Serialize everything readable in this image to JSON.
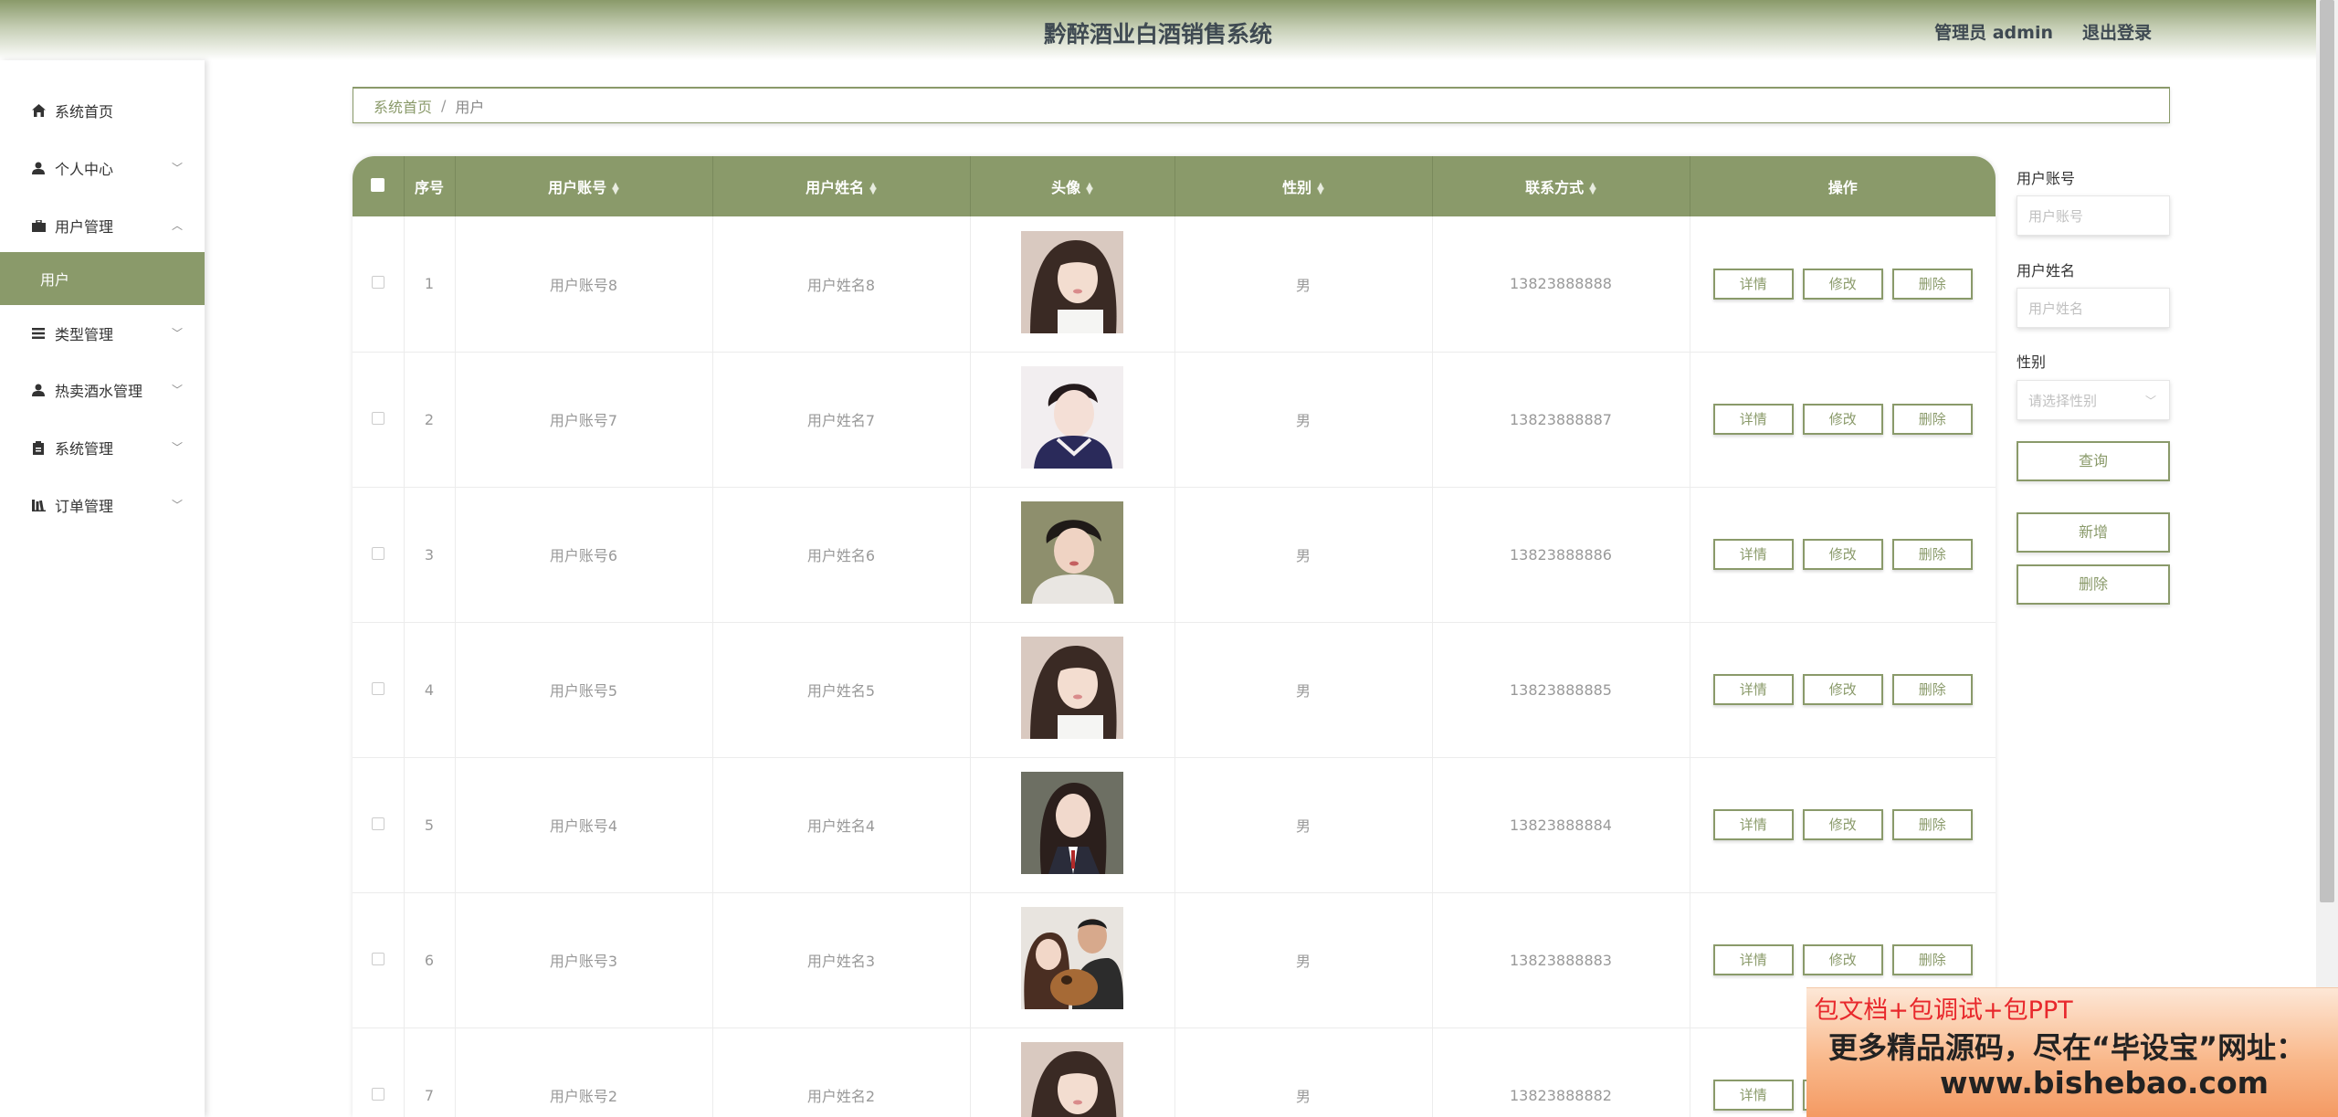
{
  "header": {
    "title": "黔醉酒业白酒销售系统",
    "user_label": "管理员 admin",
    "logout_label": "退出登录"
  },
  "sidebar": {
    "items": [
      {
        "label": "系统首页",
        "icon": "home-icon",
        "expandable": false
      },
      {
        "label": "个人中心",
        "icon": "user-icon",
        "expandable": true,
        "expanded": false
      },
      {
        "label": "用户管理",
        "icon": "briefcase-icon",
        "expandable": true,
        "expanded": true
      },
      {
        "label": "用户",
        "icon": "",
        "expandable": false,
        "active": true
      },
      {
        "label": "类型管理",
        "icon": "list-icon",
        "expandable": true,
        "expanded": false
      },
      {
        "label": "热卖酒水管理",
        "icon": "user-icon",
        "expandable": true,
        "expanded": false
      },
      {
        "label": "系统管理",
        "icon": "clipboard-icon",
        "expandable": true,
        "expanded": false
      },
      {
        "label": "订单管理",
        "icon": "library-icon",
        "expandable": true,
        "expanded": false
      }
    ]
  },
  "breadcrumb": {
    "home": "系统首页",
    "separator": "/",
    "current": "用户"
  },
  "table": {
    "columns": [
      "序号",
      "用户账号",
      "用户姓名",
      "头像",
      "性别",
      "联系方式",
      "操作"
    ],
    "rows": [
      {
        "index": "1",
        "account": "用户账号8",
        "name": "用户姓名8",
        "gender": "男",
        "phone": "13823888888",
        "avatar": "avatar-girl-1"
      },
      {
        "index": "2",
        "account": "用户账号7",
        "name": "用户姓名7",
        "gender": "男",
        "phone": "13823888887",
        "avatar": "avatar-boy-1"
      },
      {
        "index": "3",
        "account": "用户账号6",
        "name": "用户姓名6",
        "gender": "男",
        "phone": "13823888886",
        "avatar": "avatar-boy-2"
      },
      {
        "index": "4",
        "account": "用户账号5",
        "name": "用户姓名5",
        "gender": "男",
        "phone": "13823888885",
        "avatar": "avatar-girl-1"
      },
      {
        "index": "5",
        "account": "用户账号4",
        "name": "用户姓名4",
        "gender": "男",
        "phone": "13823888884",
        "avatar": "avatar-girl-2"
      },
      {
        "index": "6",
        "account": "用户账号3",
        "name": "用户姓名3",
        "gender": "男",
        "phone": "13823888883",
        "avatar": "avatar-couple"
      },
      {
        "index": "7",
        "account": "用户账号2",
        "name": "用户姓名2",
        "gender": "男",
        "phone": "13823888882",
        "avatar": "avatar-girl-1"
      }
    ],
    "actions": {
      "detail": "详情",
      "edit": "修改",
      "delete": "删除"
    }
  },
  "search_panel": {
    "account_label": "用户账号",
    "account_placeholder": "用户账号",
    "name_label": "用户姓名",
    "name_placeholder": "用户姓名",
    "gender_label": "性别",
    "gender_placeholder": "请选择性别",
    "query_button": "查询",
    "add_button": "新增",
    "delete_button": "删除"
  },
  "ad_banner": {
    "line1": "包文档+包调试+包PPT",
    "line2": "更多精品源码，尽在“毕设宝”网址：",
    "line3": "www.bishebao.com"
  },
  "colors": {
    "accent": "#8a9a6a",
    "header_text": "#3f4a52",
    "ad_red": "#e8282c"
  }
}
